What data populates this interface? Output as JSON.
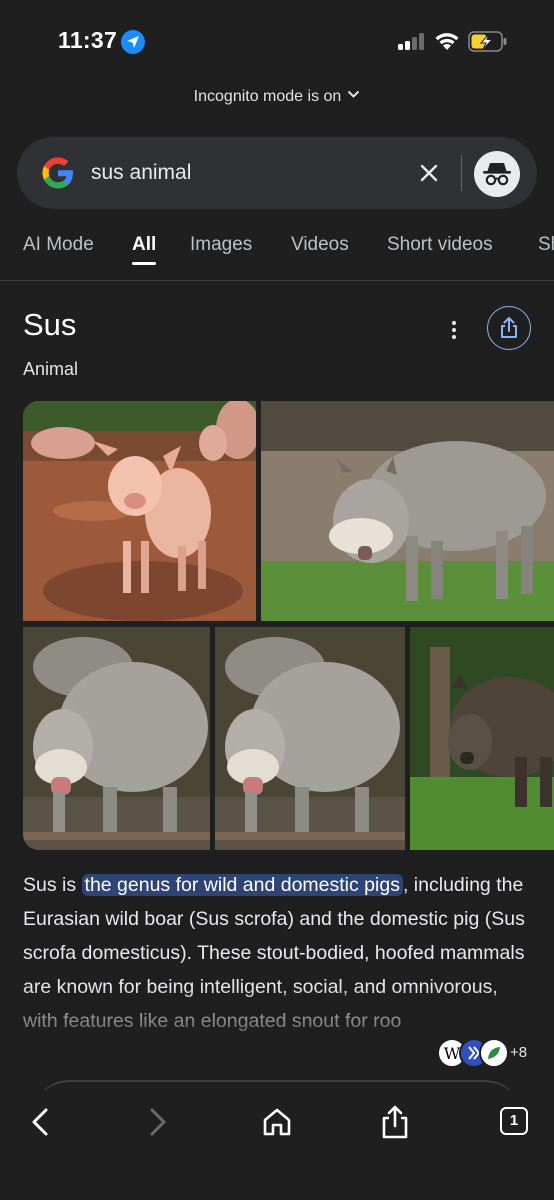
{
  "status_bar": {
    "time": "11:37",
    "location_icon": "location-arrow-icon",
    "signal_icon": "cellular-signal-icon",
    "wifi_icon": "wifi-icon",
    "battery_icon": "battery-charging-icon"
  },
  "incognito_banner": {
    "label": "Incognito mode is on"
  },
  "search": {
    "query": "sus animal",
    "logo_icon": "google-g-icon",
    "clear_icon": "close-icon",
    "incognito_icon": "incognito-icon"
  },
  "tabs": [
    {
      "label": "AI Mode",
      "active": false
    },
    {
      "label": "All",
      "active": true
    },
    {
      "label": "Images",
      "active": false
    },
    {
      "label": "Videos",
      "active": false
    },
    {
      "label": "Short videos",
      "active": false
    },
    {
      "label": "Sh",
      "active": false
    }
  ],
  "knowledge_panel": {
    "title": "Sus",
    "subtitle": "Animal",
    "more_icon": "more-vert-icon",
    "share_icon": "share-icon",
    "description_prefix": "Sus is ",
    "description_highlight": "the genus for wild and domestic pigs",
    "description_rest": ", including the Eurasian wild boar (Sus scrofa) and the domestic pig (Sus scrofa domesticus). These stout-bodied, hoofed mammals are known for being intelligent, social, and omnivorous, with features like an elongated snout for roo",
    "sources_more": "+8"
  },
  "toolbar": {
    "back_icon": "back-chevron-icon",
    "forward_icon": "forward-chevron-icon",
    "home_icon": "home-icon",
    "share_icon": "share-icon",
    "tab_count": "1"
  },
  "colors": {
    "background": "#1f1f1f",
    "search_bar": "#303134",
    "highlight": "#304375",
    "accent_blue": "#8ab4f8"
  }
}
